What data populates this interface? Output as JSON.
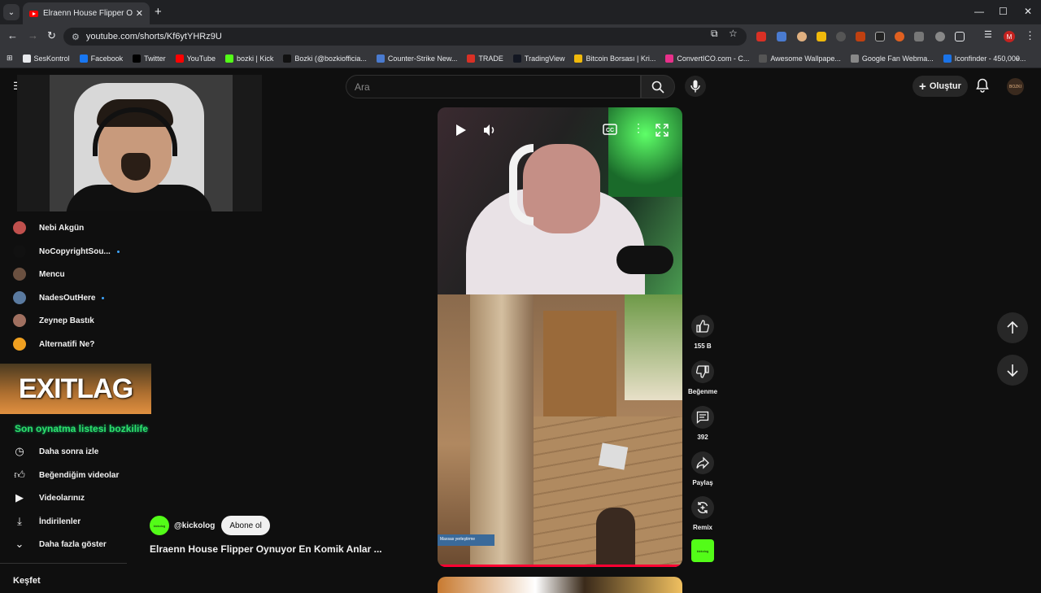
{
  "browser": {
    "tab_title": "Elraenn House Flipper Oynuyor",
    "url": "youtube.com/shorts/Kf6ytYHRz9U",
    "profile_initial": "M",
    "bookmarks": [
      {
        "label": "SesKontrol",
        "color": "#e8eaed"
      },
      {
        "label": "Facebook",
        "color": "#1877f2"
      },
      {
        "label": "Twitter",
        "color": "#000000"
      },
      {
        "label": "YouTube",
        "color": "#ff0000"
      },
      {
        "label": "bozki | Kick",
        "color": "#53fc18"
      },
      {
        "label": "Bozki (@bozkiofficia...",
        "color": "#111111"
      },
      {
        "label": "Counter-Strike New...",
        "color": "#4a7bd0"
      },
      {
        "label": "TRADE",
        "color": "#d93025"
      },
      {
        "label": "TradingView",
        "color": "#131722"
      },
      {
        "label": "Bitcoin Borsası | Kri...",
        "color": "#f0b90b"
      },
      {
        "label": "ConvertICO.com - C...",
        "color": "#e8308a"
      },
      {
        "label": "Awesome Wallpape...",
        "color": "#555555"
      },
      {
        "label": "Google Fan Webma...",
        "color": "#888888"
      },
      {
        "label": "Iconfinder - 450,000...",
        "color": "#1a73e8"
      }
    ]
  },
  "youtube": {
    "search_placeholder": "Ara",
    "create_label": "Oluştur",
    "avatar_text": "BOZKI"
  },
  "sidebar": {
    "subscriptions": [
      {
        "name": "Nebi Akgün",
        "color": "#c0504d",
        "live": false
      },
      {
        "name": "NoCopyrightSou...",
        "color": "#111111",
        "live": true
      },
      {
        "name": "Mencu",
        "color": "#6a5040",
        "live": false
      },
      {
        "name": "NadesOutHere",
        "color": "#5a7aa0",
        "live": true
      },
      {
        "name": "Zeynep Bastık",
        "color": "#a07060",
        "live": false
      },
      {
        "name": "Alternatifi Ne?",
        "color": "#f0a020",
        "live": false
      }
    ],
    "exitlag_logo": "EXITLAG",
    "overlay_name": "Son oynatma listesi   bozkilife",
    "library": [
      {
        "label": "Daha sonra izle",
        "icon": "clock-icon"
      },
      {
        "label": "Beğendiğim videolar",
        "icon": "thumbs-up-icon"
      },
      {
        "label": "Videolarınız",
        "icon": "play-square-icon"
      },
      {
        "label": "İndirilenler",
        "icon": "download-icon"
      },
      {
        "label": "Daha fazla göster",
        "icon": "chevron-down-icon"
      }
    ],
    "explore_heading": "Keşfet"
  },
  "short": {
    "channel_handle": "@kickolog",
    "channel_avatar_text": "kickolog",
    "subscribe_label": "Abone ol",
    "title": "Elraenn House Flipper Oynuyor En Komik Anlar ...",
    "game_ui_text": "Maxsas yerleştirme"
  },
  "actions": {
    "like_count": "155 B",
    "dislike_label": "Beğenme",
    "comment_count": "392",
    "share_label": "Paylaş",
    "remix_label": "Remix",
    "remix_thumb_text": "kickolog"
  }
}
